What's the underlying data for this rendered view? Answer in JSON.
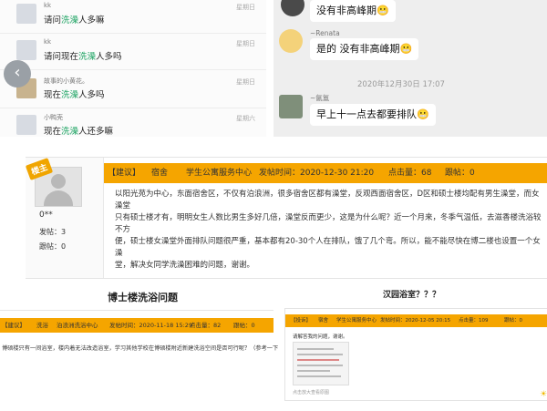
{
  "chat_list": {
    "items": [
      {
        "name": "kk",
        "prefix": "请问",
        "keyword": "洗澡",
        "suffix": "人多嘛",
        "time": "星期日"
      },
      {
        "name": "kk",
        "prefix": "请问现在",
        "keyword": "洗澡",
        "suffix": "人多吗",
        "time": "星期日"
      },
      {
        "name": "故事的小黄花。",
        "prefix": "现在",
        "keyword": "洗澡",
        "suffix": "人多吗",
        "time": "星期日"
      },
      {
        "name": "小鸭壳",
        "prefix": "现在",
        "keyword": "洗澡",
        "suffix": "人还多嘛",
        "time": "星期六"
      }
    ],
    "back_icon": "chevron-left"
  },
  "chat_right": {
    "msg1": "没有非高峰期😬",
    "sender2": "~Renata",
    "msg2": "是的 没有非高峰期😬",
    "timestamp": "2020年12月30日 17:07",
    "sender3": "~氤氲",
    "msg3": "早上十一点去都要排队😬"
  },
  "post": {
    "badge": "楼主",
    "user_name": "0**",
    "posts_label": "发帖：3",
    "replies_label": "跟帖：0",
    "tag": "【建议】",
    "board": "宿舍",
    "dept": "学生公寓服务中心",
    "date_label": "发帖时间：2020-12-30 21:20",
    "clicks_label": "点击量：68",
    "follow_label": "跟帖：0",
    "body_lines": [
      "以阳光苑为中心，东面宿舍区，不仅有泊浪洲，很多宿舍区都有澡堂，反观西面宿舍区，D区和硕士楼均配有男生澡堂，而女澡堂",
      "只有硕士楼才有，明明女生人数比男生多好几倍，澡堂反而更少，这是为什么呢？近一个月来，冬季气温低，去滋香楼洗浴较不方",
      "便，硕士楼女澡堂外面排队问题很严重，基本都有20-30个人在排队，饿了几个弯。所以，能不能尽快在博二楼也设置一个女澡",
      "堂，解决女同学洗澡困难的问题，谢谢。"
    ]
  },
  "left_post": {
    "title": "博士楼洗浴问题",
    "tag": "【建议】",
    "board": "洗浴",
    "dept": "泊浪洲洗浴中心",
    "date_label": "发帖时间：2020-11-18 15:29",
    "clicks_label": "点击量：82",
    "follow_label": "跟帖：0",
    "body": "博硕楼只有一间浴室，楼内着无法改造浴室，学习其他学校在博硕楼附近新建洗浴空间是否可行呢？（参考一下"
  },
  "right_post": {
    "title": "汉园浴室？？？",
    "tag": "【投诉】",
    "board": "宿舍",
    "dept": "学生公寓服务中心",
    "date_label": "发帖时间：2020-12-05 20:15",
    "clicks_label": "点击量：109",
    "follow_label": "跟帖：0",
    "body": "请解答我的问题，谢谢。",
    "footer": "点击放大查看原图"
  }
}
